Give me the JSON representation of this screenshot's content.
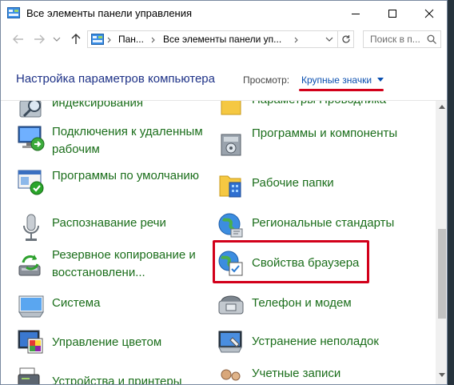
{
  "window": {
    "title": "Все элементы панели управления",
    "controls": {
      "minimize": "minimize-icon",
      "maximize": "maximize-icon",
      "close": "close-icon"
    }
  },
  "toolbar": {
    "breadcrumbs": [
      "Пан...",
      "Все элементы панели уп..."
    ],
    "search_placeholder": "Поиск в п..."
  },
  "header": {
    "title": "Настройка параметров компьютера",
    "view_label": "Просмотр:",
    "view_value": "Крупные значки"
  },
  "items_left": [
    {
      "label": "индексирования",
      "icon": "indexing-icon"
    },
    {
      "label": "Подключения к удаленным рабочим",
      "icon": "remote-desktop-icon"
    },
    {
      "label": "Программы по умолчанию",
      "icon": "default-programs-icon"
    },
    {
      "label": "Распознавание речи",
      "icon": "microphone-icon"
    },
    {
      "label": "Резервное копирование и восстановлени...",
      "icon": "backup-icon"
    },
    {
      "label": "Система",
      "icon": "system-icon"
    },
    {
      "label": "Управление цветом",
      "icon": "color-management-icon"
    },
    {
      "label": "Устройства и принтеры",
      "icon": "devices-printers-icon"
    }
  ],
  "items_right": [
    {
      "label": "Параметры Проводника",
      "icon": "folder-options-icon"
    },
    {
      "label": "Программы и компоненты",
      "icon": "programs-features-icon"
    },
    {
      "label": "Рабочие папки",
      "icon": "work-folders-icon"
    },
    {
      "label": "Региональные стандарты",
      "icon": "region-icon"
    },
    {
      "label": "Свойства браузера",
      "icon": "internet-options-icon"
    },
    {
      "label": "Телефон и модем",
      "icon": "phone-modem-icon"
    },
    {
      "label": "Устранение неполадок",
      "icon": "troubleshooting-icon"
    },
    {
      "label": "Учетные записи",
      "icon": "user-accounts-icon"
    }
  ],
  "colors": {
    "link_green": "#1b6e1b",
    "header_blue": "#1e3287",
    "highlight_red": "#d2001a"
  }
}
